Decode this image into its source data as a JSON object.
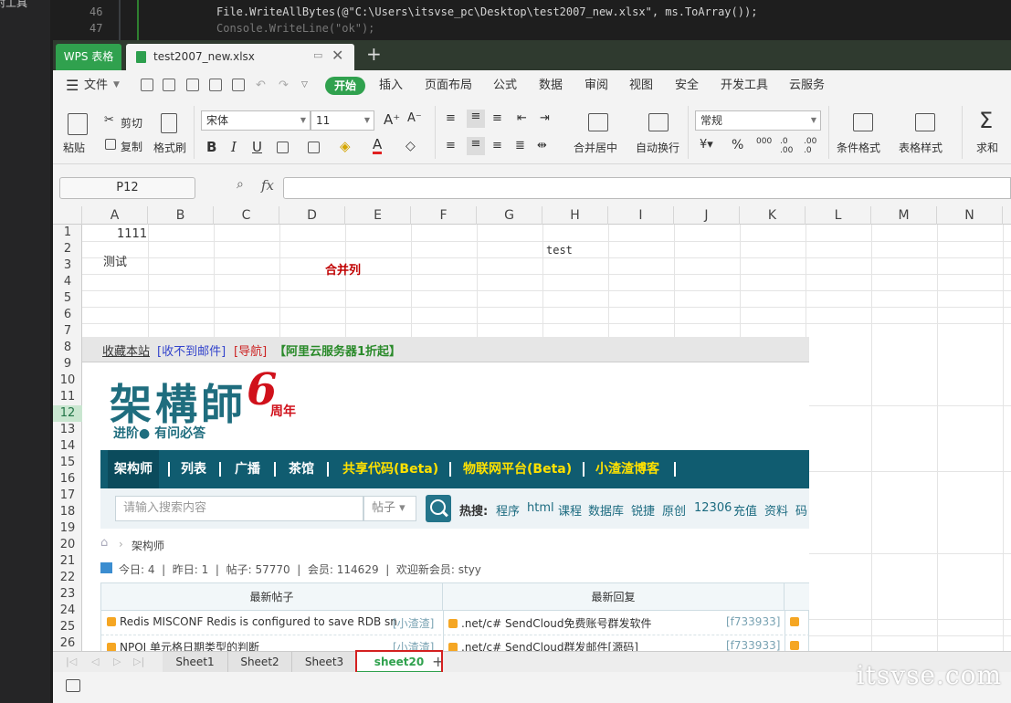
{
  "ide": {
    "panel_label": "封工具",
    "lines": [
      {
        "num": "46",
        "code": "File.WriteAllBytes(@\"C:\\Users\\itsvse_pc\\Desktop\\test2007_new.xlsx\", ms.ToArray());"
      },
      {
        "num": "47",
        "code": "Console.WriteLine(\"ok\");"
      }
    ]
  },
  "wps": {
    "app_tab": "WPS 表格",
    "file_tab": "test2007_new.xlsx",
    "menu": {
      "file": "文件",
      "start": "开始",
      "items": [
        "插入",
        "页面布局",
        "公式",
        "数据",
        "审阅",
        "视图",
        "安全",
        "开发工具",
        "云服务"
      ]
    },
    "ribbon": {
      "paste": "粘贴",
      "cut": "剪切",
      "copy": "复制",
      "format_painter": "格式刷",
      "font_name": "宋体",
      "font_size": "11",
      "bold": "B",
      "italic": "I",
      "underline": "U",
      "merge_center": "合并居中",
      "wrap_text": "自动换行",
      "number_format": "常规",
      "percent": "%",
      "cond_format": "条件格式",
      "table_style": "表格样式",
      "sum": "求和"
    },
    "formula_bar": {
      "name_box": "P12",
      "fx": "fx",
      "value": ""
    },
    "columns": [
      "A",
      "B",
      "C",
      "D",
      "E",
      "F",
      "G",
      "H",
      "I",
      "J",
      "K",
      "L",
      "M",
      "N"
    ],
    "rows": [
      "1",
      "2",
      "3",
      "4",
      "5",
      "6",
      "7",
      "8",
      "9",
      "10",
      "11",
      "12",
      "13",
      "14",
      "15",
      "16",
      "17",
      "18",
      "19",
      "20",
      "21",
      "22",
      "23",
      "24",
      "25",
      "26"
    ],
    "selected_row": "12",
    "cells": {
      "a1": "1111",
      "a2": "测试",
      "h2": "test",
      "merged": "合并列"
    },
    "sheets": [
      "Sheet1",
      "Sheet2",
      "Sheet3",
      "sheet20"
    ],
    "active_sheet": "sheet20",
    "colors": {
      "brand_green": "#30a14e",
      "highlight_red": "#d42020"
    }
  },
  "embedded_image": {
    "top_links": [
      "收藏本站",
      "[收不到邮件]",
      "[导航]",
      "【阿里云服务器1折起】"
    ],
    "logo": "架構師",
    "logo_number": "6",
    "logo_suffix": "周年",
    "slogan": "进阶● 有问必答",
    "nav": [
      "架构师",
      "列表",
      "广播",
      "茶馆",
      "共享代码(Beta)",
      "物联网平台(Beta)",
      "小渣渣博客"
    ],
    "search_placeholder": "请输入搜索内容",
    "search_type": "帖子",
    "hot_label": "热搜:",
    "hot_words": [
      "程序",
      "html",
      "课程",
      "数据库",
      "锐捷",
      "原创",
      "12306",
      "充值",
      "资料",
      "码"
    ],
    "breadcrumb": "架构师",
    "stats": "今日: 4  |  昨日: 1  |  帖子: 57770  |  会员: 114629  |  欢迎新会员: styy",
    "table_headers": [
      "最新帖子",
      "最新回复"
    ],
    "posts": [
      {
        "title": "Redis MISCONF Redis is configured to save RDB sn",
        "author": "[小渣渣]",
        "reply": ".net/c# SendCloud免费账号群发软件",
        "reply_author": "[f733933]"
      },
      {
        "title": "NPOI 单元格日期类型的判断",
        "author": "[小渣渣]",
        "reply": ".net/c# SendCloud群发邮件[源码]",
        "reply_author": "[f733933]"
      }
    ]
  },
  "watermark": "itsvse.com"
}
